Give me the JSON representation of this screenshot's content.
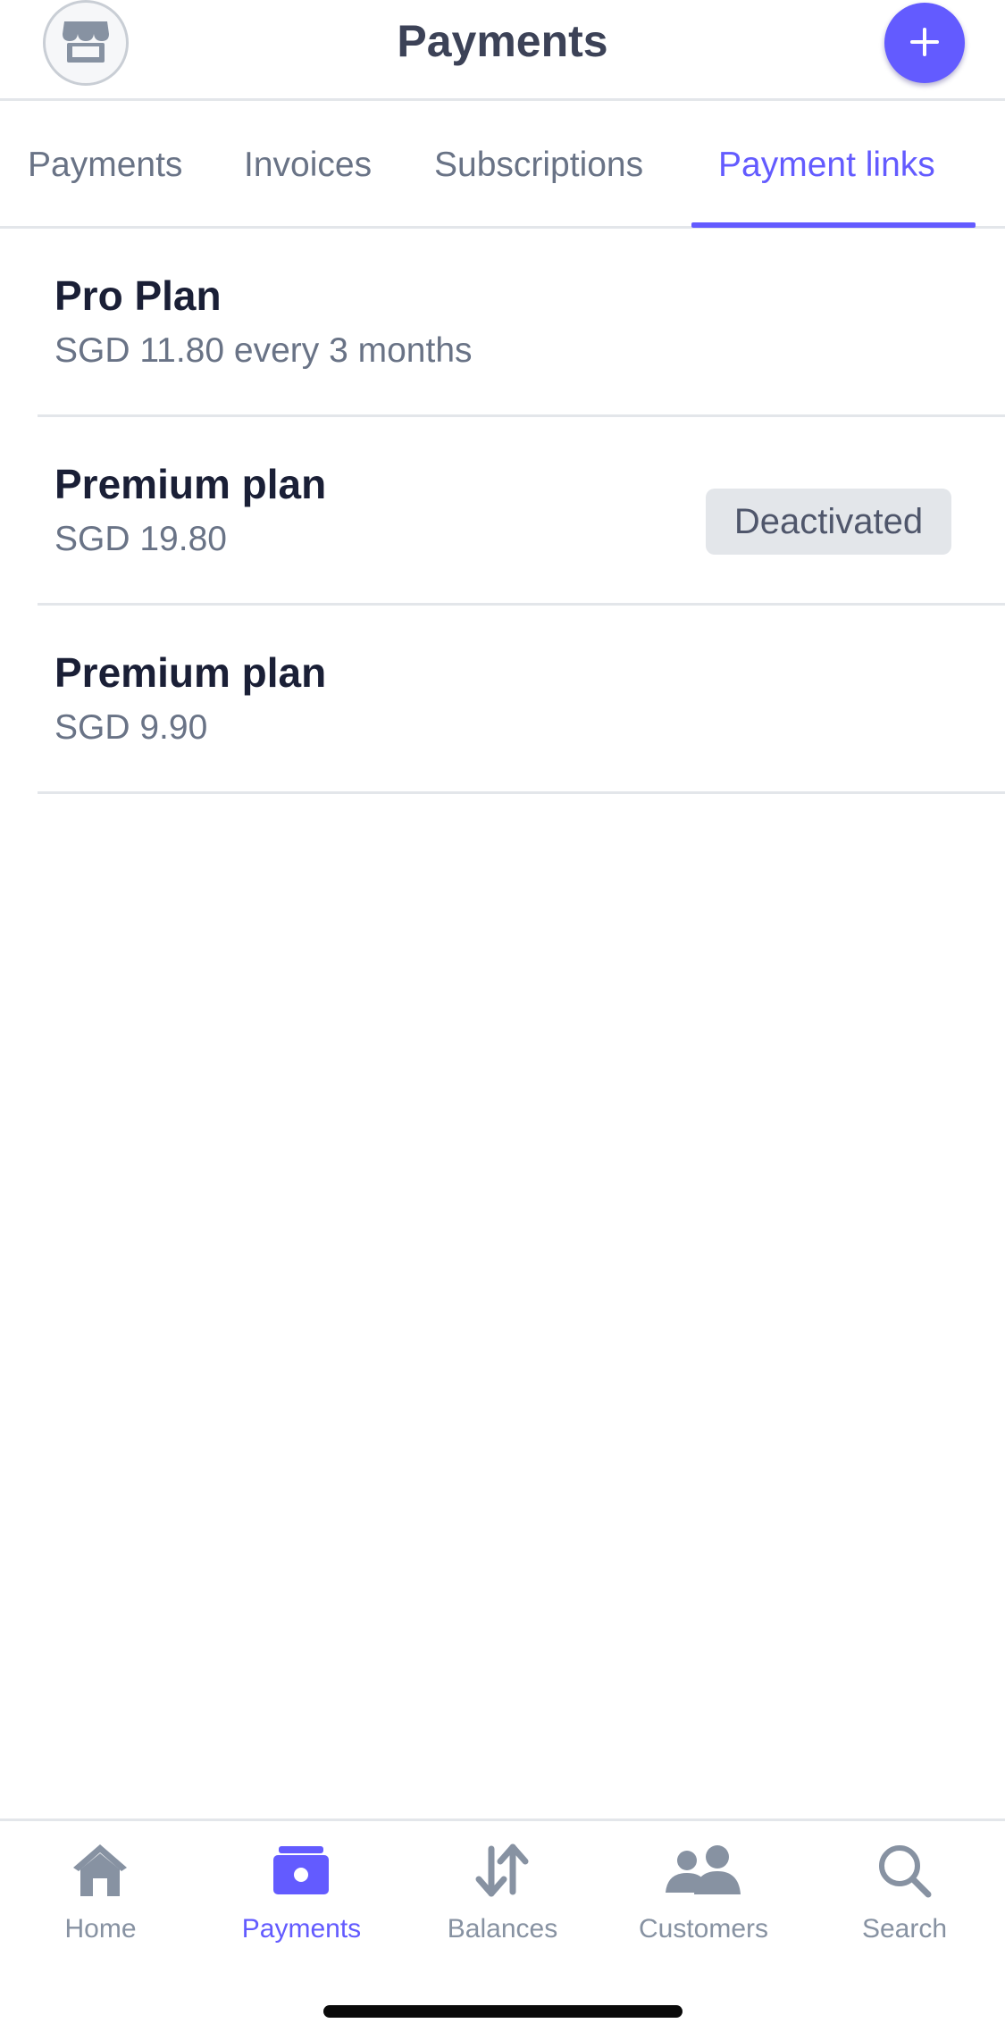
{
  "header": {
    "title": "Payments",
    "avatar_icon": "store-icon",
    "add_icon": "plus-icon"
  },
  "tabs": [
    {
      "label": "Payments",
      "active": false
    },
    {
      "label": "Invoices",
      "active": false
    },
    {
      "label": "Subscriptions",
      "active": false
    },
    {
      "label": "Payment links",
      "active": true
    }
  ],
  "payment_links": [
    {
      "title": "Pro Plan",
      "price": "SGD 11.80 every 3 months",
      "status": ""
    },
    {
      "title": "Premium plan",
      "price": "SGD 19.80",
      "status": "Deactivated"
    },
    {
      "title": "Premium plan",
      "price": "SGD 9.90",
      "status": ""
    }
  ],
  "bottom_nav": [
    {
      "label": "Home",
      "icon": "home-icon",
      "active": false
    },
    {
      "label": "Payments",
      "icon": "payments-icon",
      "active": true
    },
    {
      "label": "Balances",
      "icon": "balances-icon",
      "active": false
    },
    {
      "label": "Customers",
      "icon": "customers-icon",
      "active": false
    },
    {
      "label": "Search",
      "icon": "search-icon",
      "active": false
    }
  ],
  "colors": {
    "accent": "#635bff",
    "title_text": "#3c4257",
    "body_text": "#1a1f36",
    "muted_text": "#697386",
    "badge_bg": "#e3e6ea",
    "divider": "#e3e6ea"
  }
}
